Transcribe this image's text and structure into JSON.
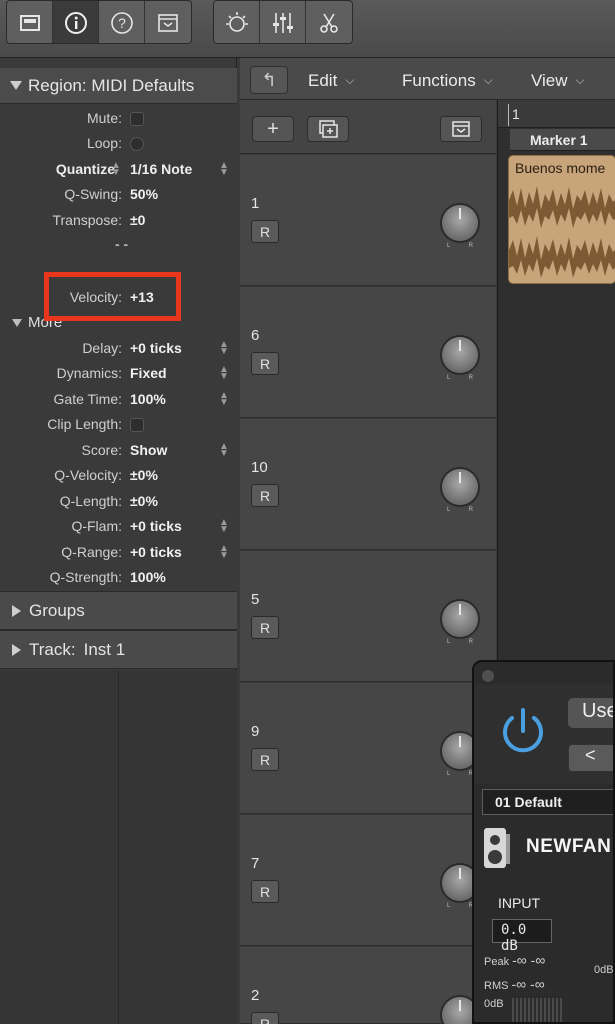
{
  "toolbar": {
    "left_icons": [
      "inbox-tray-icon",
      "info-icon",
      "help-question-icon",
      "dropdown-box-icon"
    ],
    "right_icons": [
      "smart-controls-icon",
      "mixer-sliders-icon",
      "scissors-icon"
    ]
  },
  "inspector": {
    "region_header": "Region: MIDI Defaults",
    "params": [
      {
        "label": "Mute:",
        "type": "checkbox"
      },
      {
        "label": "Loop:",
        "type": "checkbox"
      },
      {
        "label": "Quantize",
        "value": "1/16 Note",
        "stepper": true
      },
      {
        "label": "Q-Swing:",
        "value": "50%"
      },
      {
        "label": "Transpose:",
        "value": "±0"
      },
      {
        "label": "",
        "value": "- -"
      },
      {
        "label": "Velocity:",
        "value": "+13"
      }
    ],
    "more_label": "More",
    "more_params": [
      {
        "label": "Delay:",
        "value": "+0 ticks",
        "stepper": true
      },
      {
        "label": "Dynamics:",
        "value": "Fixed",
        "stepper": true
      },
      {
        "label": "Gate Time:",
        "value": "100%",
        "stepper": true
      },
      {
        "label": "Clip Length:",
        "type": "checkbox"
      },
      {
        "label": "Score:",
        "value": "Show",
        "stepper": true
      },
      {
        "label": "Q-Velocity:",
        "value": "±0%"
      },
      {
        "label": "Q-Length:",
        "value": "±0%"
      },
      {
        "label": "Q-Flam:",
        "value": "+0 ticks",
        "stepper": true
      },
      {
        "label": "Q-Range:",
        "value": "+0 ticks",
        "stepper": true
      },
      {
        "label": "Q-Strength:",
        "value": "100%"
      }
    ],
    "groups_label": "Groups",
    "track_label": "Track:",
    "track_name": "Inst 1"
  },
  "local_menu": {
    "edit": "Edit",
    "functions": "Functions",
    "view": "View"
  },
  "tracks": [
    {
      "number": "1",
      "record_label": "R"
    },
    {
      "number": "6",
      "record_label": "R"
    },
    {
      "number": "10",
      "record_label": "R"
    },
    {
      "number": "5",
      "record_label": "R"
    },
    {
      "number": "9",
      "record_label": "R"
    },
    {
      "number": "7",
      "record_label": "R"
    },
    {
      "number": "2",
      "record_label": "R"
    }
  ],
  "arrange": {
    "bar_number": "1",
    "marker": "Marker 1",
    "region_name": "Buenos mome"
  },
  "plugin": {
    "user_button": "Use",
    "nav_prev": "<",
    "preset": "01 Default",
    "brand": "NEWFAN",
    "input_label": "INPUT",
    "input_value": "0.0 dB",
    "peak_label": "Peak",
    "peak_value": "-∞ -∞",
    "rms_label": "RMS",
    "rms_value": "-∞ -∞",
    "odb_left": "0dB",
    "odb_right": "0dB"
  },
  "colors": {
    "highlight": "#e8361d",
    "audio_region": "#c7a47a",
    "power_icon": "#4a9fe0"
  }
}
